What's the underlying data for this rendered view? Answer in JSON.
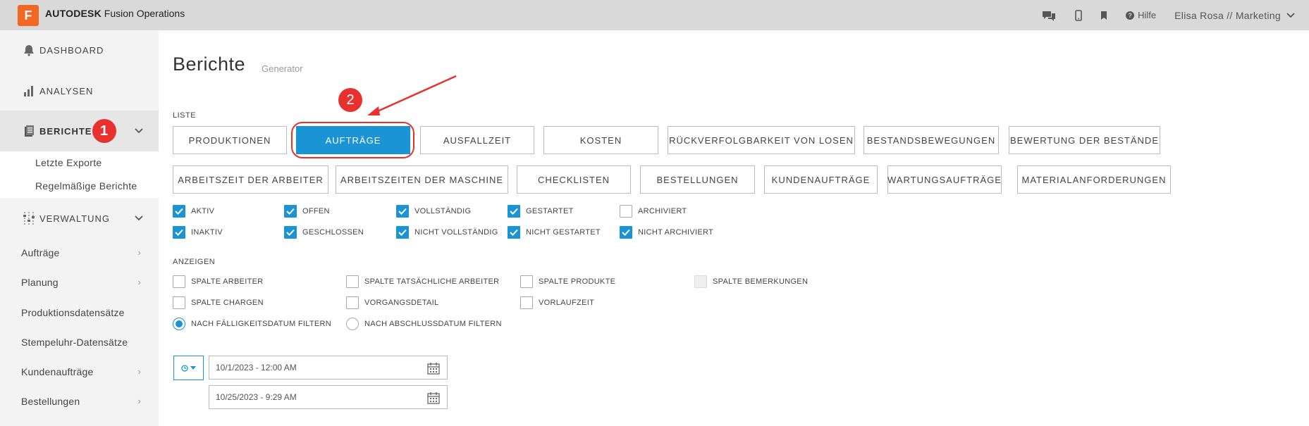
{
  "header": {
    "logo_letter": "F",
    "brand_bold": "AUTODESK",
    "brand_rest": "Fusion Operations",
    "help_label": "Hilfe",
    "user_label": "Elisa Rosa // Marketing",
    "icons": [
      "chat-icon",
      "mobile-icon",
      "bookmark-icon",
      "help-icon",
      "chevron-down-icon"
    ]
  },
  "sidebar": {
    "dashboard": "DASHBOARD",
    "analysen": "ANALYSEN",
    "berichte": "BERICHTE",
    "berichte_badge": "1",
    "sub_items": [
      "Letzte Exporte",
      "Regelmäßige Berichte"
    ],
    "verwaltung": "VERWALTUNG",
    "items": [
      {
        "label": "Aufträge",
        "arrow": "›"
      },
      {
        "label": "Planung",
        "arrow": "›"
      },
      {
        "label": "Produktionsdatensätze",
        "arrow": ""
      },
      {
        "label": "Stempeluhr-Datensätze",
        "arrow": ""
      },
      {
        "label": "Kundenaufträge",
        "arrow": "›"
      },
      {
        "label": "Bestellungen",
        "arrow": "›"
      }
    ]
  },
  "page": {
    "title": "Berichte",
    "subtitle": "Generator",
    "liste_label": "LISTE",
    "anzeigen_label": "ANZEIGEN",
    "annotation_badge": "2"
  },
  "tabs_row1": [
    "PRODUKTIONEN",
    "AUFTRÄGE",
    "AUSFALLZEIT",
    "KOSTEN",
    "RÜCKVERFOLGBARKEIT VON LOSEN",
    "BESTANDSBEWEGUNGEN",
    "BEWERTUNG DER BESTÄNDE"
  ],
  "tabs_row2": [
    "ARBEITSZEIT DER ARBEITER",
    "ARBEITSZEITEN DER MASCHINE",
    "CHECKLISTEN",
    "BESTELLUNGEN",
    "KUNDENAUFTRÄGE",
    "WARTUNGSAUFTRÄGE",
    "MATERIALANFORDERUNGEN"
  ],
  "active_tab": "AUFTRÄGE",
  "filters": [
    {
      "label": "AKTIV",
      "checked": true
    },
    {
      "label": "OFFEN",
      "checked": true
    },
    {
      "label": "VOLLSTÄNDIG",
      "checked": true
    },
    {
      "label": "GESTARTET",
      "checked": true
    },
    {
      "label": "ARCHIVIERT",
      "checked": false
    },
    {
      "label": "INAKTIV",
      "checked": true
    },
    {
      "label": "GESCHLOSSEN",
      "checked": true
    },
    {
      "label": "NICHT VOLLSTÄNDIG",
      "checked": true
    },
    {
      "label": "NICHT GESTARTET",
      "checked": true
    },
    {
      "label": "NICHT ARCHIVIERT",
      "checked": true
    }
  ],
  "display_options": [
    {
      "label": "SPALTE ARBEITER",
      "checked": false
    },
    {
      "label": "SPALTE TATSÄCHLICHE ARBEITER",
      "checked": false
    },
    {
      "label": "SPALTE PRODUKTE",
      "checked": false
    },
    {
      "label": "SPALTE BEMERKUNGEN",
      "checked": false,
      "disabled": true
    },
    {
      "label": "SPALTE CHARGEN",
      "checked": false
    },
    {
      "label": "VORGANGSDETAIL",
      "checked": false
    },
    {
      "label": "VORLAUFZEIT",
      "checked": false
    }
  ],
  "radios": [
    {
      "label": "NACH FÄLLIGKEITSDATUM FILTERN",
      "selected": true
    },
    {
      "label": "NACH ABSCHLUSSDATUM FILTERN",
      "selected": false
    }
  ],
  "dates": {
    "start": "10/1/2023 - 12:00 AM",
    "end": "10/25/2023 - 9:29 AM"
  },
  "colors": {
    "accent": "#1b94d6",
    "annotation": "#e8312f",
    "brand": "#f26722"
  }
}
